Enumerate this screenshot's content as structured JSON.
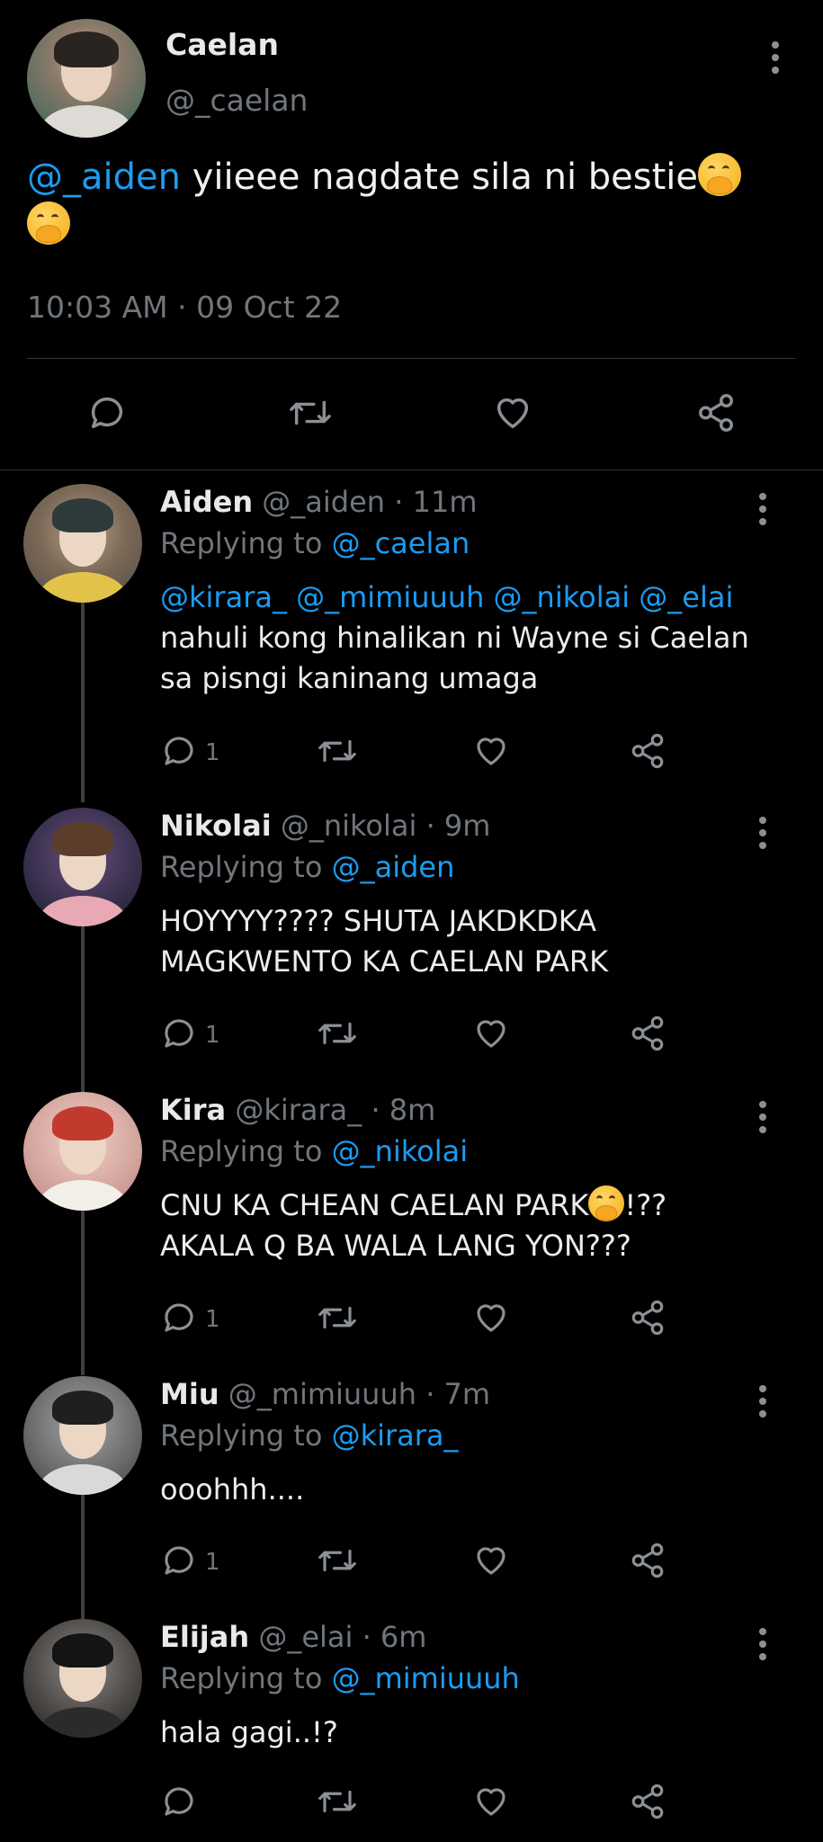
{
  "main_tweet": {
    "name": "Caelan",
    "handle": "@_caelan",
    "mention": "@_aiden",
    "text": " yiieee nagdate sila ni bestie",
    "timestamp": "10:03 AM · 09 Oct 22"
  },
  "replies": [
    {
      "name": "Aiden",
      "meta": " @_aiden · 11m",
      "replying_prefix": "Replying to ",
      "replying_to": "@_caelan",
      "mentions_line": "@kirara_ @_mimiuuuh @_nikolai @_elai",
      "line1": "nahuli kong hinalikan ni Wayne si Caelan",
      "line2": "sa pisngi kaninang umaga",
      "reply_count": "1"
    },
    {
      "name": "Nikolai",
      "meta": " @_nikolai · 9m",
      "replying_prefix": "Replying to ",
      "replying_to": "@_aiden",
      "line1": "HOYYYY???? SHUTA JAKDKDKA",
      "line2": "MAGKWENTO KA CAELAN PARK",
      "reply_count": "1"
    },
    {
      "name": "Kira",
      "meta": " @kirara_ · 8m",
      "replying_prefix": "Replying to ",
      "replying_to": "@_nikolai",
      "line1a": "CNU KA CHEAN CAELAN PARK",
      "line1b": "!??",
      "line2": "AKALA Q BA WALA LANG YON???",
      "reply_count": "1"
    },
    {
      "name": "Miu",
      "meta": " @_mimiuuuh · 7m",
      "replying_prefix": "Replying to ",
      "replying_to": "@kirara_",
      "line1": "ooohhh....",
      "reply_count": "1"
    },
    {
      "name": "Elijah",
      "meta": "  @_elai · 6m",
      "replying_prefix": "Replying to ",
      "replying_to": "@_mimiuuuh",
      "line1": "hala gagi..!?"
    }
  ],
  "colors": {
    "background": "#000000",
    "mention": "#1d9bf0",
    "muted": "#71767b",
    "text": "#e7e9ea"
  },
  "icons": [
    "reply-icon",
    "retweet-icon",
    "like-icon",
    "share-icon",
    "more-icon"
  ]
}
